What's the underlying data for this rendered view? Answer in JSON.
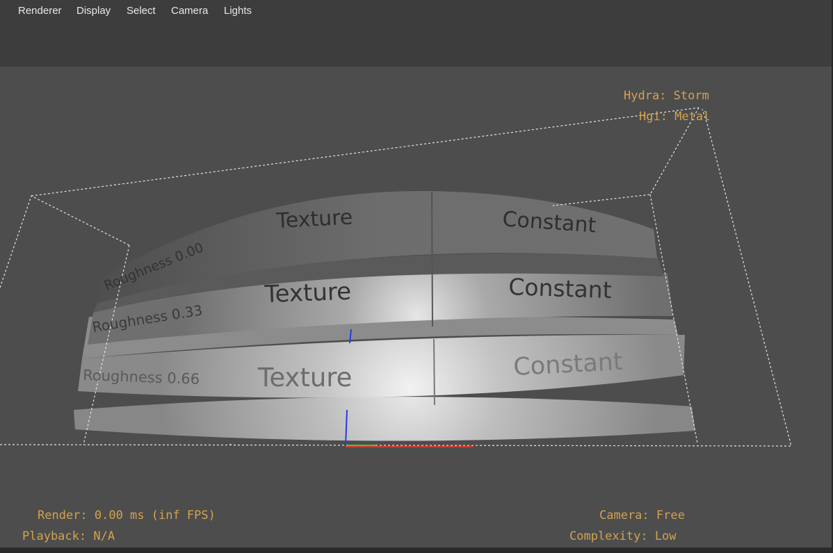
{
  "menu": {
    "items": [
      "Renderer",
      "Display",
      "Select",
      "Camera",
      "Lights"
    ]
  },
  "hud": {
    "renderer": "Hydra: Storm",
    "hgi": "Hgi: Metal",
    "render_stats": "Render: 0.00 ms (inf FPS)",
    "playback": "Playback: N/A",
    "camera": "Camera: Free",
    "complexity": "Complexity: Low"
  },
  "scene": {
    "labels": {
      "row0_left": "Roughness 0.00",
      "row1_left": "Roughness 0.33",
      "row2_left": "Roughness 0.66",
      "texture": "Texture",
      "constant": "Constant"
    },
    "axis_colors": {
      "x": "#d23a2a",
      "y": "#43c43c",
      "z": "#2a3ae0"
    },
    "hud_color": "#d4a24e"
  }
}
